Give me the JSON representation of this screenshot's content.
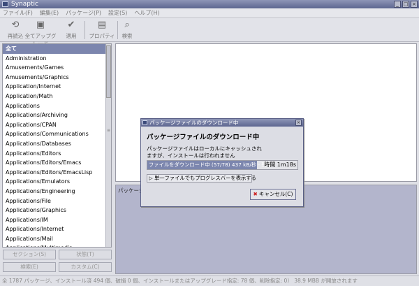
{
  "window": {
    "title": "Synaptic"
  },
  "menu": [
    "ファイル(F)",
    "編集(E)",
    "パッケージ(P)",
    "設定(S)",
    "ヘルプ(H)"
  ],
  "toolbar": [
    {
      "label": "再読込",
      "icon": "reload-icon",
      "glyph": "⟲"
    },
    {
      "label": "全てアップグレード",
      "icon": "upgrade-icon",
      "glyph": "▣"
    },
    {
      "label": "適用",
      "icon": "apply-icon",
      "glyph": "✔"
    },
    {
      "label": "プロパティ",
      "icon": "properties-icon",
      "glyph": "▤"
    },
    {
      "label": "検索",
      "icon": "search-icon",
      "glyph": "⌕"
    }
  ],
  "sections": [
    "全て",
    "Administration",
    "Amusements/Games",
    "Amusements/Graphics",
    "Application/Internet",
    "Application/Math",
    "Applications",
    "Applications/Archiving",
    "Applications/CPAN",
    "Applications/Communications",
    "Applications/Databases",
    "Applications/Editors",
    "Applications/Editors/Emacs",
    "Applications/Editors/EmacsLisp",
    "Applications/Emulators",
    "Applications/Engineering",
    "Applications/File",
    "Applications/Graphics",
    "Applications/IM",
    "Applications/Internet",
    "Applications/Mail",
    "Applications/Multimedia"
  ],
  "buttons": {
    "sections": "セクション(S)",
    "status": "状態(T)",
    "search": "検索(E)",
    "custom": "カスタム(C)"
  },
  "desc_label": "パッケージ",
  "statusbar": "全 1787 パッケージ、インストール済 494 個、破損 0 個、インストールまたはアップグレード指定: 78 個、削除指定: 0） 38.9 MBB が開放されます",
  "dialog": {
    "title": "パッケージファイルのダウンロード中",
    "heading": "パッケージファイルのダウンロード中",
    "message_line1": "パッケージファイルはローカルにキャッシュされ",
    "message_line2": "ますが、インストールは行われません",
    "progress_text": "ファイルをダウンロード中 (57/78) 437 kB/秒 - 残り",
    "progress_fraction": 0.73,
    "progress_time_label": "時間",
    "progress_time": "1m18s",
    "expander_label": "単一ファイルでもプログレスバーを表示する",
    "cancel_label": "キャンセル(C)"
  }
}
